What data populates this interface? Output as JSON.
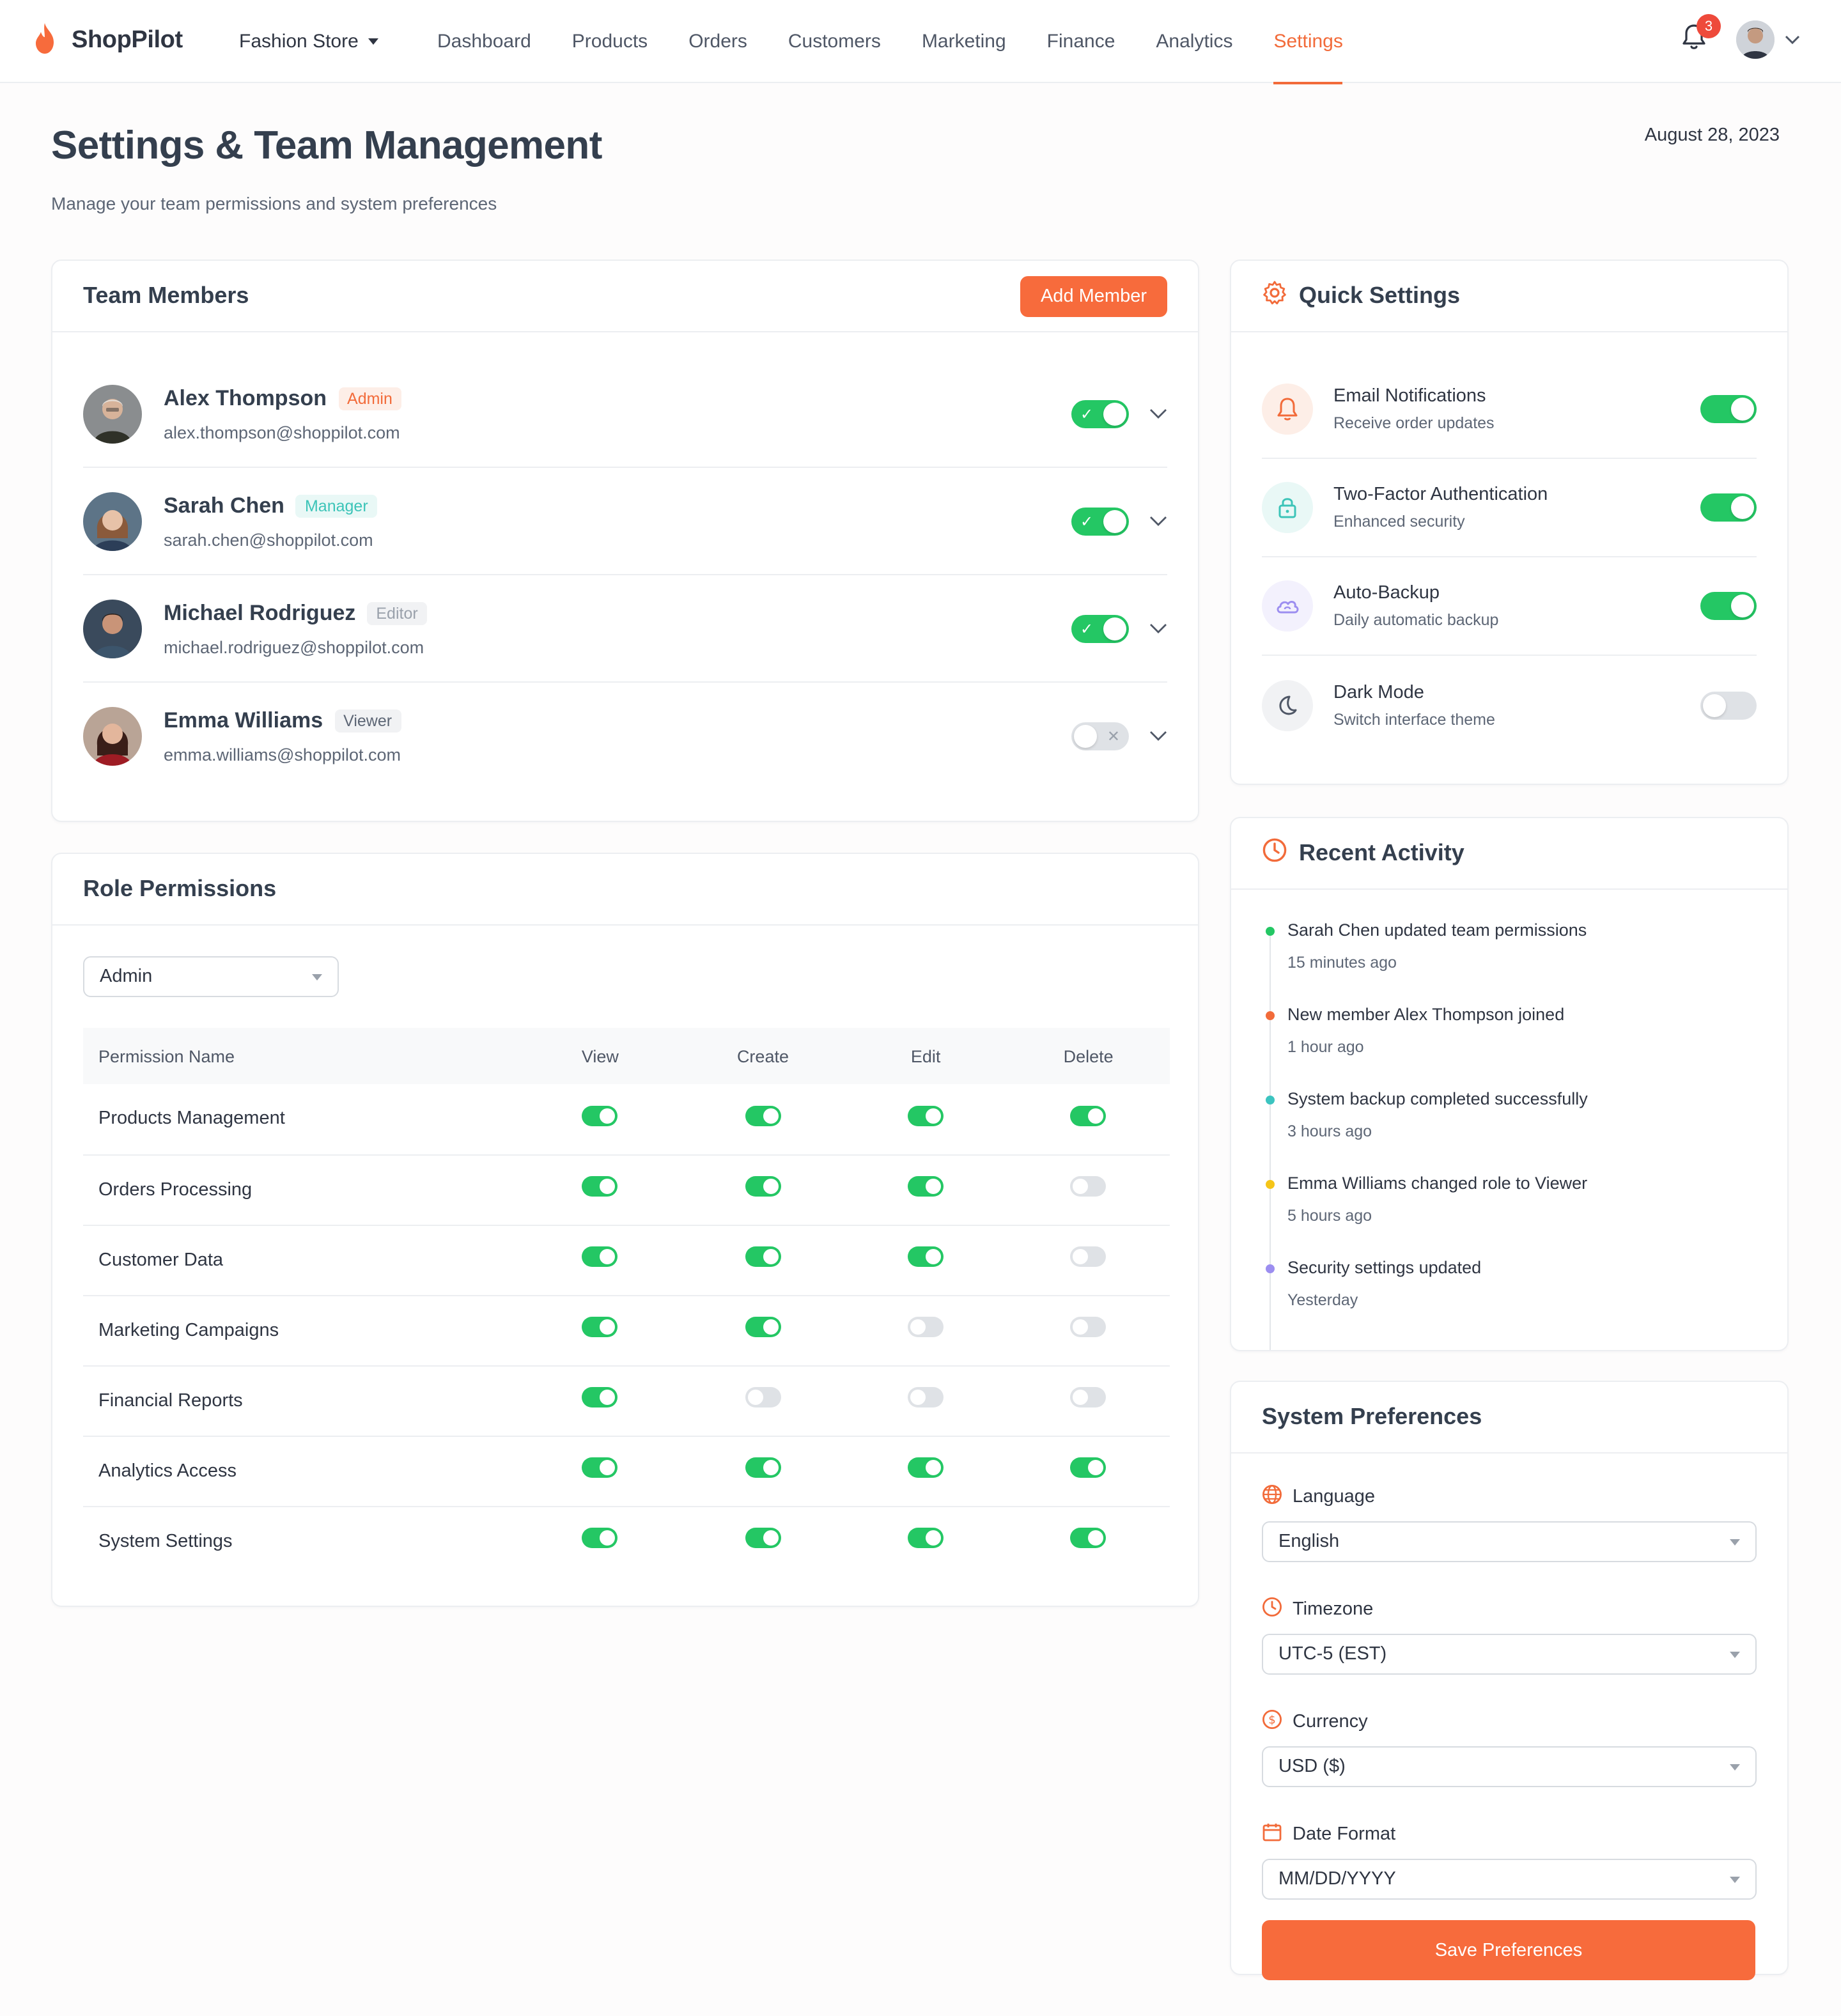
{
  "brand": {
    "name": "ShopPilot",
    "accent": "#f76b3c"
  },
  "store": {
    "name": "Fashion Store"
  },
  "nav": {
    "links": [
      "Dashboard",
      "Products",
      "Orders",
      "Customers",
      "Marketing",
      "Finance",
      "Analytics",
      "Settings"
    ],
    "active": "Settings",
    "notification_count": "3"
  },
  "header": {
    "title": "Settings & Team Management",
    "subtitle": "Manage your team permissions and system preferences",
    "date": "August 28, 2023"
  },
  "team": {
    "title": "Team Members",
    "add_label": "Add Member",
    "members": [
      {
        "name": "Alex Thompson",
        "role": "Admin",
        "email": "alex.thompson@shoppilot.com",
        "active": true
      },
      {
        "name": "Sarah Chen",
        "role": "Manager",
        "email": "sarah.chen@shoppilot.com",
        "active": true
      },
      {
        "name": "Michael Rodriguez",
        "role": "Editor",
        "email": "michael.rodriguez@shoppilot.com",
        "active": true
      },
      {
        "name": "Emma Williams",
        "role": "Viewer",
        "email": "emma.williams@shoppilot.com",
        "active": false
      }
    ]
  },
  "roles": {
    "title": "Role Permissions",
    "selected_role": "Admin",
    "columns": [
      "Permission Name",
      "View",
      "Create",
      "Edit",
      "Delete"
    ],
    "rows": [
      {
        "name": "Products Management",
        "perms": [
          true,
          true,
          true,
          true
        ]
      },
      {
        "name": "Orders Processing",
        "perms": [
          true,
          true,
          true,
          false
        ]
      },
      {
        "name": "Customer Data",
        "perms": [
          true,
          true,
          true,
          false
        ]
      },
      {
        "name": "Marketing Campaigns",
        "perms": [
          true,
          true,
          false,
          false
        ]
      },
      {
        "name": "Financial Reports",
        "perms": [
          true,
          false,
          false,
          false
        ]
      },
      {
        "name": "Analytics Access",
        "perms": [
          true,
          true,
          true,
          true
        ]
      },
      {
        "name": "System Settings",
        "perms": [
          true,
          true,
          true,
          true
        ]
      }
    ]
  },
  "quick": {
    "title": "Quick Settings",
    "items": [
      {
        "name": "Email Notifications",
        "desc": "Receive order updates",
        "on": true,
        "icon": "bell-icon"
      },
      {
        "name": "Two-Factor Authentication",
        "desc": "Enhanced security",
        "on": true,
        "icon": "lock-icon"
      },
      {
        "name": "Auto-Backup",
        "desc": "Daily automatic backup",
        "on": true,
        "icon": "cloud-icon"
      },
      {
        "name": "Dark Mode",
        "desc": "Switch interface theme",
        "on": false,
        "icon": "moon-icon"
      }
    ]
  },
  "activity": {
    "title": "Recent Activity",
    "items": [
      {
        "text": "Sarah Chen updated team permissions",
        "time": "15 minutes ago",
        "color": "#24c764"
      },
      {
        "text": "New member Alex Thompson joined",
        "time": "1 hour ago",
        "color": "#f26b3a"
      },
      {
        "text": "System backup completed successfully",
        "time": "3 hours ago",
        "color": "#3cc4c0"
      },
      {
        "text": "Emma Williams changed role to Viewer",
        "time": "5 hours ago",
        "color": "#f5c518"
      },
      {
        "text": "Security settings updated",
        "time": "Yesterday",
        "color": "#9c8ef0"
      }
    ]
  },
  "prefs": {
    "title": "System Preferences",
    "fields": [
      {
        "label": "Language",
        "value": "English",
        "icon": "globe-icon"
      },
      {
        "label": "Timezone",
        "value": "UTC-5 (EST)",
        "icon": "clock-icon"
      },
      {
        "label": "Currency",
        "value": "USD ($)",
        "icon": "dollar-icon"
      },
      {
        "label": "Date Format",
        "value": "MM/DD/YYYY",
        "icon": "calendar-icon"
      }
    ],
    "save_label": "Save Preferences"
  }
}
